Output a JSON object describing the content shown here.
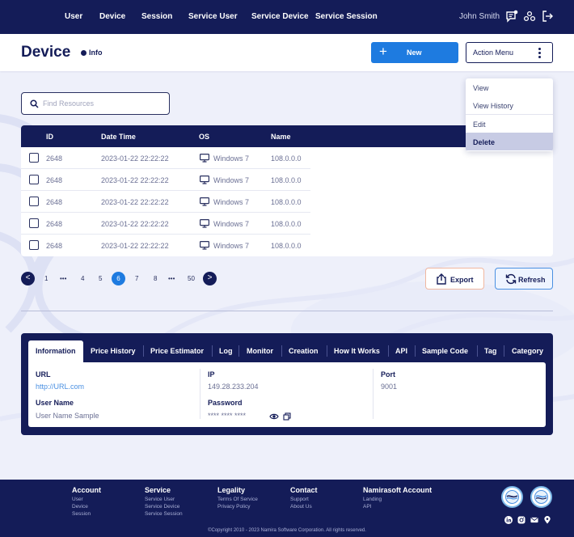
{
  "nav": {
    "items": [
      "User",
      "Device",
      "Session",
      "Service User",
      "Service Device",
      "Service Session"
    ],
    "user_name": "John Smith",
    "icons": [
      "notification-icon",
      "settings-icon",
      "logout-icon"
    ]
  },
  "header": {
    "title": "Device",
    "info_label": "Info",
    "new_label": "New",
    "action_menu_label": "Action Menu"
  },
  "action_menu": {
    "items": [
      "View",
      "View History",
      "Edit",
      "Delete"
    ],
    "selected": "Delete"
  },
  "search": {
    "placeholder": "Find Resources"
  },
  "table": {
    "columns": [
      "ID",
      "Date Time",
      "OS",
      "Name"
    ],
    "rows": [
      {
        "id": "2648",
        "datetime": "2023-01-22 22:22:22",
        "os": "Windows 7",
        "name": "108.0.0.0"
      },
      {
        "id": "2648",
        "datetime": "2023-01-22 22:22:22",
        "os": "Windows 7",
        "name": "108.0.0.0"
      },
      {
        "id": "2648",
        "datetime": "2023-01-22 22:22:22",
        "os": "Windows 7",
        "name": "108.0.0.0"
      },
      {
        "id": "2648",
        "datetime": "2023-01-22 22:22:22",
        "os": "Windows 7",
        "name": "108.0.0.0"
      },
      {
        "id": "2648",
        "datetime": "2023-01-22 22:22:22",
        "os": "Windows 7",
        "name": "108.0.0.0"
      }
    ]
  },
  "pagination": {
    "prev": "<",
    "next": ">",
    "pages": [
      "1",
      "•••",
      "4",
      "5",
      "6",
      "7",
      "8",
      "•••",
      "50"
    ],
    "current": "6"
  },
  "actions": {
    "export_label": "Export",
    "refresh_label": "Refresh"
  },
  "details": {
    "tabs": [
      "Information",
      "Price History",
      "Price Estimator",
      "Log",
      "Monitor",
      "Creation",
      "How It Works",
      "API",
      "Sample Code",
      "Tag",
      "Category"
    ],
    "active_tab": "Information",
    "fields": {
      "url_label": "URL",
      "url_value": "http://URL.com",
      "ip_label": "IP",
      "ip_value": "149.28.233.204",
      "port_label": "Port",
      "port_value": "9001",
      "username_label": "User Name",
      "username_value": "User Name Sample",
      "password_label": "Password",
      "password_value": "**** **** ****"
    }
  },
  "footer": {
    "columns": [
      {
        "title": "Account",
        "links": [
          "User",
          "Device",
          "Session"
        ]
      },
      {
        "title": "Service",
        "links": [
          "Service User",
          "Service Device",
          "Service Session"
        ]
      },
      {
        "title": "Legality",
        "links": [
          "Terms Of Service",
          "Privacy Policy"
        ]
      },
      {
        "title": "Contact",
        "links": [
          "Support",
          "About Us"
        ]
      },
      {
        "title": "Namirasoft Account",
        "links": [
          "Landing",
          "API"
        ]
      }
    ],
    "copyright": "©Copyright 2010 - 2023 Namira Software Corporation. All rights reserved.",
    "social_icons": [
      "linkedin-icon",
      "instagram-icon",
      "email-icon",
      "location-icon"
    ]
  },
  "colors": {
    "primary": "#141c58",
    "accent": "#1e7be0",
    "background": "#eef0fa"
  }
}
